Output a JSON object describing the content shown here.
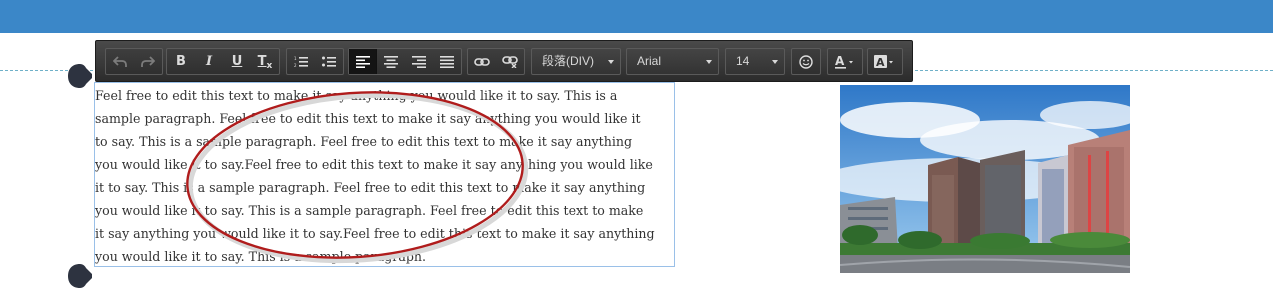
{
  "toolbar": {
    "undo_icon": "undo-icon",
    "redo_icon": "redo-icon",
    "bold_label": "B",
    "italic_label": "I",
    "underline_label": "U",
    "clear_format_label": "T",
    "paragraph_format": "段落(DIV)",
    "font_family": "Arial",
    "font_size": "14"
  },
  "paragraph": {
    "lines": [
      "Feel free to edit this text to make it say anything you would like it to say.  This is a",
      "sample paragraph.  Feel free to edit this text to make it say anything you would like it",
      "to say.  This is a sample paragraph.  Feel free to edit this text to make it say anything",
      "you would like it to say.Feel free to edit this text to make it say anything you would like",
      "it to say.  This is a sample paragraph.  Feel free to edit this text to make it say anything",
      "you would like it to say.  This is a sample paragraph.  Feel free to edit this text to make",
      "it say anything you would like it to say.Feel free to edit this text to make it say anything",
      "you would like it to say.  This is a sample paragraph."
    ]
  },
  "colors": {
    "topbar": "#3b87c8",
    "toolbar_bg": "#333333",
    "selection_border": "#9ac0e8",
    "annotation_ellipse": "#b01c1c"
  }
}
